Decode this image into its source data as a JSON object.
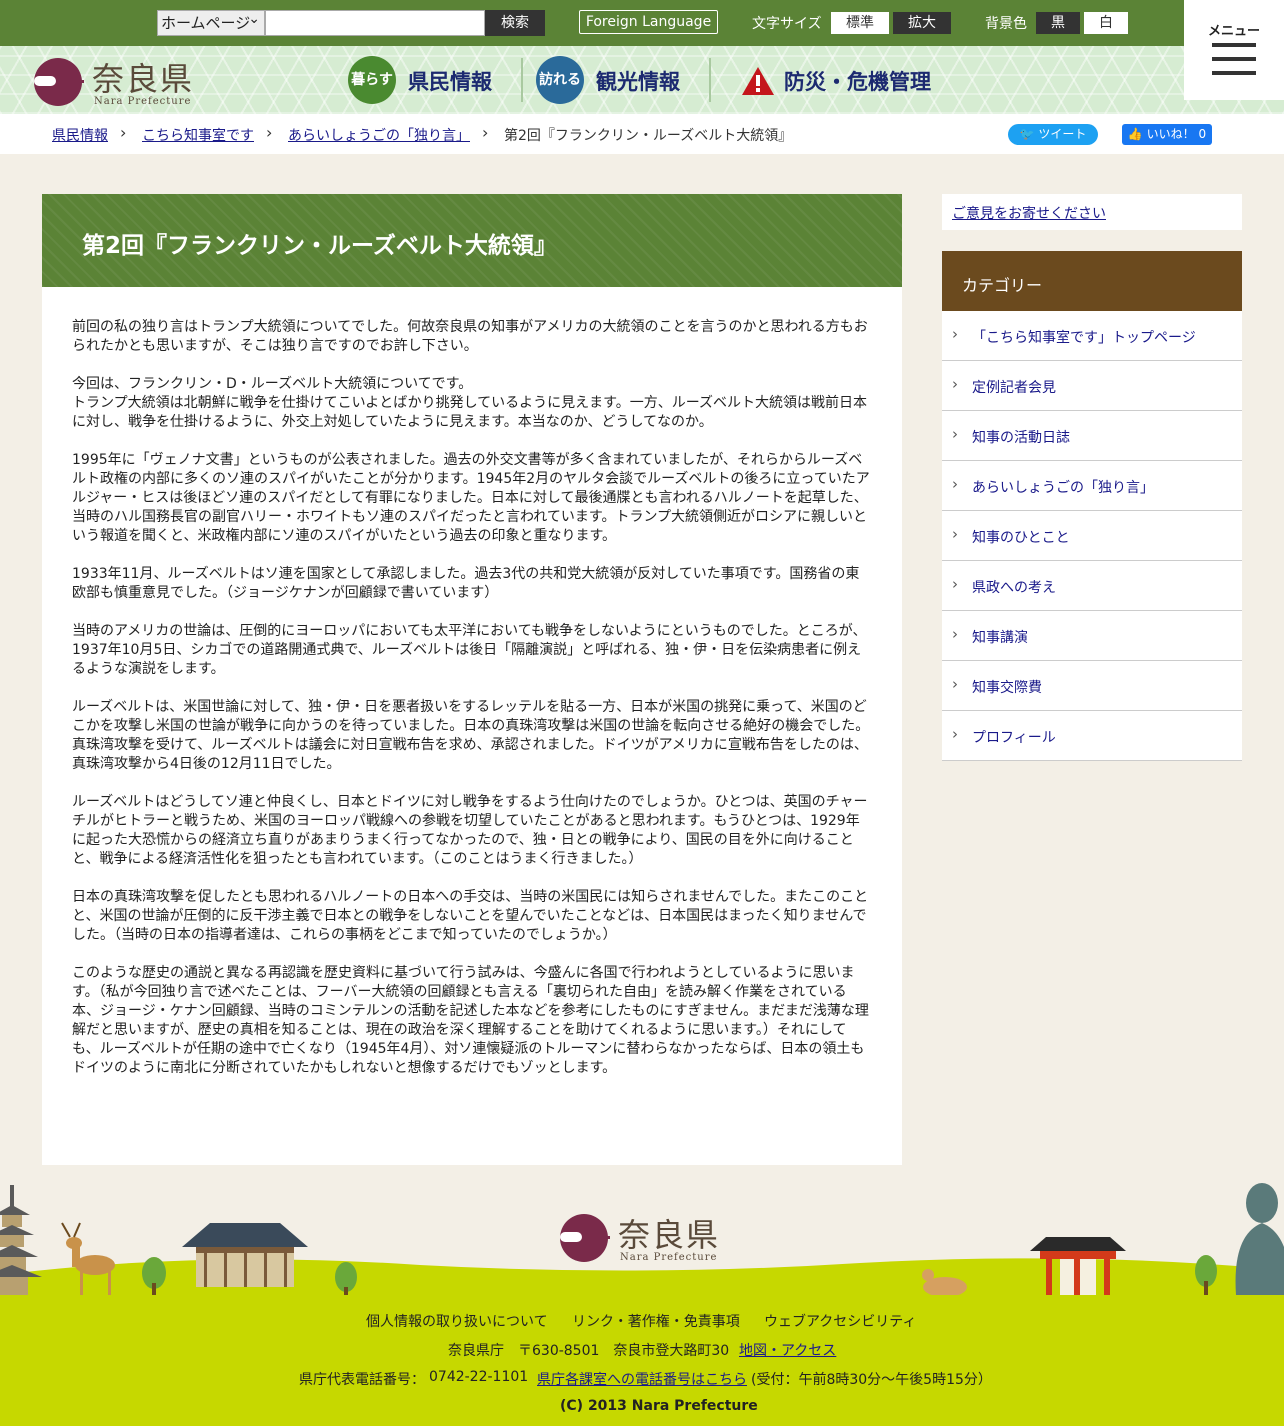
{
  "topbar": {
    "site_select": "ホームページ",
    "search_button": "検索",
    "foreign_language": "Foreign Language",
    "fontsize_label": "文字サイズ",
    "fontsize_standard": "標準",
    "fontsize_large": "拡大",
    "bgcolor_label": "背景色",
    "bg_black": "黒",
    "bg_white": "白",
    "menu_label": "メニュー"
  },
  "header": {
    "logo_text": "奈良県",
    "logo_sub": "Nara Prefecture",
    "nav": [
      {
        "icon_text": "暮らす",
        "label": "県民情報",
        "color": "#4a8a30"
      },
      {
        "icon_text": "訪れる",
        "label": "観光情報",
        "color": "#2a6a9a"
      },
      {
        "icon_text": "",
        "label": "防災・危機管理",
        "color": "#c4161c"
      }
    ]
  },
  "breadcrumb": {
    "items": [
      "県民情報",
      "こちら知事室です",
      "あらいしょうごの「独り言」",
      "第2回『フランクリン・ルーズベルト大統領』"
    ],
    "tweet": "ツイート",
    "like": "いいね！ 0"
  },
  "article": {
    "title": "第2回『フランクリン・ルーズベルト大統領』",
    "paragraphs": [
      "前回の私の独り言はトランプ大統領についてでした。何故奈良県の知事がアメリカの大統領のことを言うのかと思われる方もおられたかとも思いますが、そこは独り言ですのでお許し下さい。",
      "今回は、フランクリン・D・ルーズベルト大統領についてです。\nトランプ大統領は北朝鮮に戦争を仕掛けてこいよとばかり挑発しているように見えます。一方、ルーズベルト大統領は戦前日本に対し、戦争を仕掛けるように、外交上対処していたように見えます。本当なのか、どうしてなのか。",
      "1995年に「ヴェノナ文書」というものが公表されました。過去の外交文書等が多く含まれていましたが、それらからルーズベルト政権の内部に多くのソ連のスパイがいたことが分かります。1945年2月のヤルタ会談でルーズベルトの後ろに立っていたアルジャー・ヒスは後ほどソ連のスパイだとして有罪になりました。日本に対して最後通牒とも言われるハルノートを起草した、当時のハル国務長官の副官ハリー・ホワイトもソ連のスパイだったと言われています。トランプ大統領側近がロシアに親しいという報道を聞くと、米政権内部にソ連のスパイがいたという過去の印象と重なります。",
      "1933年11月、ルーズベルトはソ連を国家として承認しました。過去3代の共和党大統領が反対していた事項です。国務省の東欧部も慎重意見でした。（ジョージケナンが回顧録で書いています）",
      "当時のアメリカの世論は、圧倒的にヨーロッパにおいても太平洋においても戦争をしないようにというものでした。ところが、1937年10月5日、シカゴでの道路開通式典で、ルーズベルトは後日「隔離演説」と呼ばれる、独・伊・日を伝染病患者に例えるような演説をします。",
      "ルーズベルトは、米国世論に対して、独・伊・日を悪者扱いをするレッテルを貼る一方、日本が米国の挑発に乗って、米国のどこかを攻撃し米国の世論が戦争に向かうのを待っていました。日本の真珠湾攻撃は米国の世論を転向させる絶好の機会でした。真珠湾攻撃を受けて、ルーズベルトは議会に対日宣戦布告を求め、承認されました。ドイツがアメリカに宣戦布告をしたのは、真珠湾攻撃から4日後の12月11日でした。",
      "ルーズベルトはどうしてソ連と仲良くし、日本とドイツに対し戦争をするよう仕向けたのでしょうか。ひとつは、英国のチャーチルがヒトラーと戦うため、米国のヨーロッパ戦線への参戦を切望していたことがあると思われます。もうひとつは、1929年に起った大恐慌からの経済立ち直りがあまりうまく行ってなかったので、独・日との戦争により、国民の目を外に向けることと、戦争による経済活性化を狙ったとも言われています。（このことはうまく行きました。）",
      "日本の真珠湾攻撃を促したとも思われるハルノートの日本への手交は、当時の米国民には知らされませんでした。またこのことと、米国の世論が圧倒的に反干渉主義で日本との戦争をしないことを望んでいたことなどは、日本国民はまったく知りませんでした。（当時の日本の指導者達は、これらの事柄をどこまで知っていたのでしょうか。）",
      "このような歴史の通説と異なる再認識を歴史資料に基づいて行う試みは、今盛んに各国で行われようとしているように思います。（私が今回独り言で述べたことは、フーバー大統領の回顧録とも言える「裏切られた自由」を読み解く作業をされている本、ジョージ・ケナン回顧録、当時のコミンテルンの活動を記述した本などを参考にしたものにすぎません。まだまだ浅薄な理解だと思いますが、歴史の真相を知ることは、現在の政治を深く理解することを助けてくれるように思います。）それにしても、ルーズベルトが任期の途中で亡くなり（1945年4月）、対ソ連懐疑派のトルーマンに替わらなかったならば、日本の領土もドイツのように南北に分断されていたかもしれないと想像するだけでもゾッとします。"
    ]
  },
  "sidebar": {
    "opinion_link": "ご意見をお寄せください",
    "category_title": "カテゴリー",
    "categories": [
      "「こちら知事室です」トップページ",
      "定例記者会見",
      "知事の活動日誌",
      "あらいしょうごの「独り言」",
      "知事のひとこと",
      "県政への考え",
      "知事講演",
      "知事交際費",
      "プロフィール"
    ]
  },
  "footer": {
    "logo_text": "奈良県",
    "logo_sub": "Nara Prefecture",
    "links": [
      "個人情報の取り扱いについて",
      "リンク・著作権・免責事項",
      "ウェブアクセシビリティ"
    ],
    "address": "奈良県庁　〒630-8501　奈良市登大路町30",
    "map_link": "地図・アクセス",
    "phone_label": "県庁代表電話番号：",
    "phone": "0742-22-1101",
    "phone_link": "県庁各課室への電話番号はこちら",
    "hours": "(受付：午前8時30分～午後5時15分）",
    "copyright": "(C) 2013 Nara Prefecture"
  },
  "colors": {
    "topbar_green": "#5b8336",
    "category_brown": "#6b4a1e",
    "footer_lime": "#c6d800",
    "logo_purple": "#7a2a4a"
  }
}
